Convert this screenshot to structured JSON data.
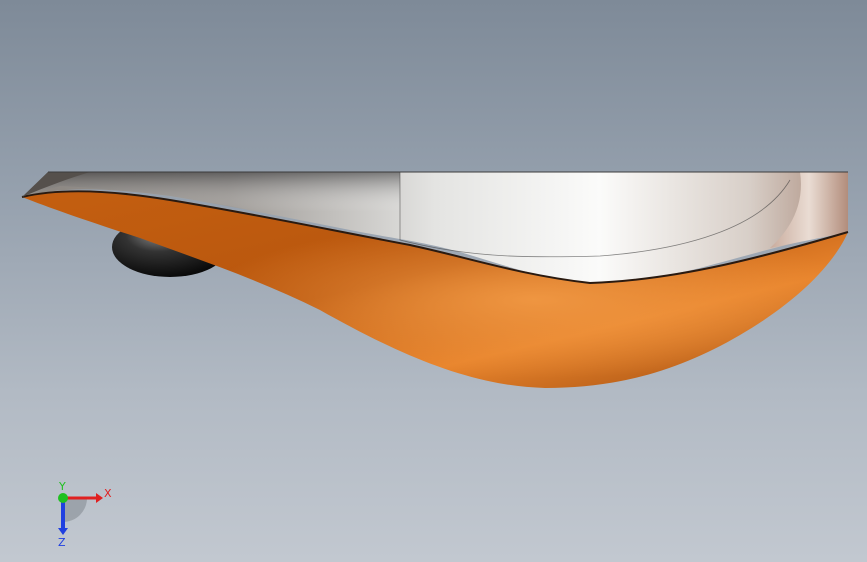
{
  "viewport": {
    "background_top": "#7e8a98",
    "background_bottom": "#c2c8d0"
  },
  "model": {
    "body_color": "#e07a2a",
    "top_color": "#d9d9d6",
    "wheel_color": "#222222"
  },
  "triad": {
    "x_label": "X",
    "y_label": "Y",
    "z_label": "Z",
    "x_color": "#e02020",
    "y_color": "#20c020",
    "z_color": "#2040e0"
  }
}
